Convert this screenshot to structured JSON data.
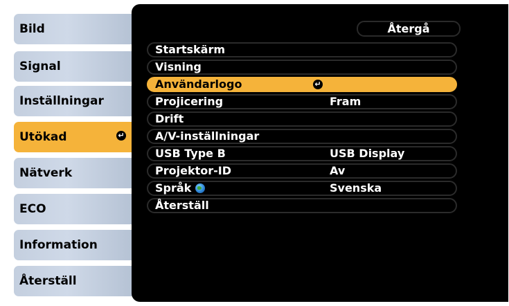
{
  "sidebar": {
    "items": [
      {
        "label": "Bild"
      },
      {
        "label": "Signal"
      },
      {
        "label": "Inställningar"
      },
      {
        "label": "Utökad",
        "active": true
      },
      {
        "label": "Nätverk"
      },
      {
        "label": "ECO"
      },
      {
        "label": "Information"
      },
      {
        "label": "Återställ"
      }
    ]
  },
  "panel": {
    "return_label": "Återgå",
    "rows": [
      {
        "label": "Startskärm",
        "value": ""
      },
      {
        "label": "Visning",
        "value": ""
      },
      {
        "label": "Användarlogo",
        "value": "",
        "selected": true
      },
      {
        "label": "Projicering",
        "value": "Fram"
      },
      {
        "label": "Drift",
        "value": ""
      },
      {
        "label": "A/V-inställningar",
        "value": ""
      },
      {
        "label": "USB Type B",
        "value": "USB Display"
      },
      {
        "label": "Projektor-ID",
        "value": "Av"
      },
      {
        "label": "Språk",
        "value": "Svenska",
        "icon": "globe-icon"
      },
      {
        "label": "Återställ",
        "value": ""
      }
    ]
  },
  "colors": {
    "accent": "#f5b33a",
    "tab": "#c9d4e4",
    "panel": "#000000"
  }
}
